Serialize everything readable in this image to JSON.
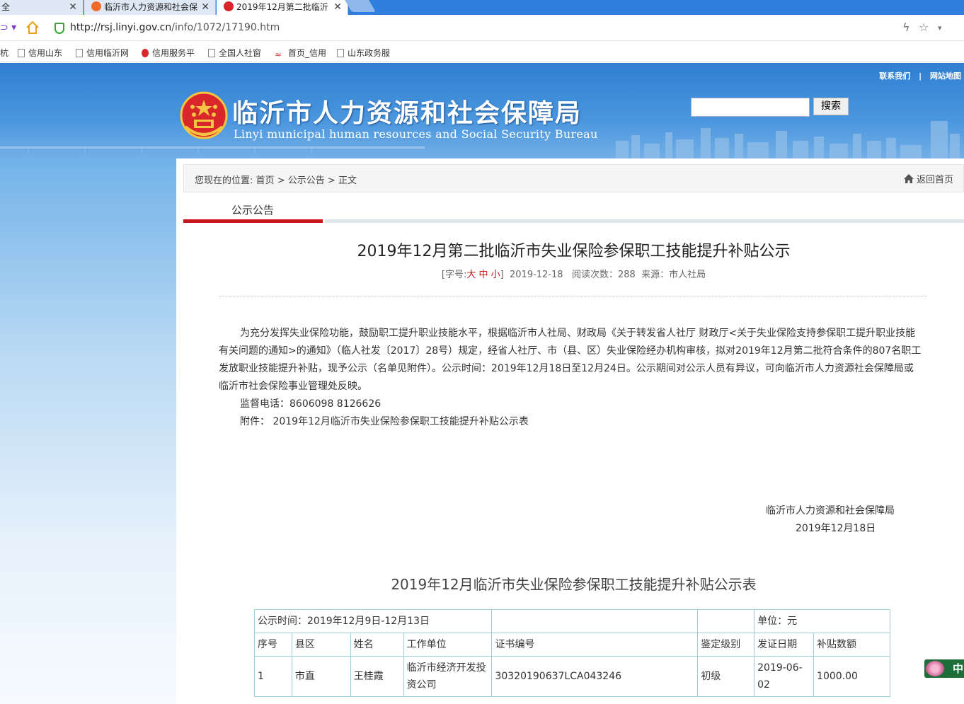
{
  "browser": {
    "tabs": [
      {
        "label": "全",
        "active": false
      },
      {
        "label": "临沂市人力资源和社会保",
        "active": false
      },
      {
        "label": "2019年12月第二批临沂",
        "active": true
      }
    ],
    "url_host": "http://rsj.linyi.gov.cn",
    "url_path": "/info/1072/17190.htm",
    "bookmarks": [
      "杭",
      "信用山东",
      "信用临沂网",
      "信用服务平",
      "全国人社窗",
      "首页_信用",
      "山东政务服"
    ]
  },
  "header": {
    "top_links": [
      "联系我们",
      "|",
      "网站地图"
    ],
    "site_title": "临沂市人力资源和社会保障局",
    "site_subtitle": "Linyi municipal human resources and Social Security Bureau",
    "search_button": "搜索",
    "search_value": ""
  },
  "breadcrumb": {
    "prefix": "您现在的位置:",
    "items": [
      "首页",
      ">",
      "公示公告",
      ">",
      "正文"
    ],
    "home_link": "返回首页"
  },
  "section_tab": "公示公告",
  "article": {
    "title": "2019年12月第二批临沂市失业保险参保职工技能提升补贴公示",
    "meta_prefix": "[字号:",
    "font_sizes": [
      "大",
      "中",
      "小"
    ],
    "meta_suffix": "]",
    "date": "2019-12-18",
    "views_label": "阅读次数：",
    "views": "288",
    "source_label": "来源：",
    "source": "市人社局",
    "paragraph": "为充分发挥失业保险功能，鼓励职工提升职业技能水平，根据临沂市人社局、财政局《关于转发省人社厅 财政厅<关于失业保险支持参保职工提升职业技能有关问题的通知>的通知》（临人社发〔2017〕28号）规定，经省人社厅、市（县、区）失业保险经办机构审核，拟对2019年12月第二批符合条件的807名职工发放职业技能提升补贴，现予公示（名单见附件）。公示时间：2019年12月18日至12月24日。公示期间对公示人员有异议，可向临沂市人力资源社会保障局或临沂市社会保险事业管理处反映。",
    "phone_line": "监督电话：8606098 8126626",
    "attachment_line": "附件： 2019年12月临沂市失业保险参保职工技能提升补贴公示表",
    "sign_org": "临沂市人力资源和社会保障局",
    "sign_date": "2019年12月18日"
  },
  "table": {
    "title": "2019年12月临沂市失业保险参保职工技能提升补贴公示表",
    "period": "公示时间：2019年12月9日-12月13日",
    "unit": "单位：元",
    "headers": [
      "序号",
      "县区",
      "姓名",
      "工作单位",
      "证书编号",
      "鉴定级别",
      "发证日期",
      "补贴数额"
    ],
    "rows": [
      [
        "1",
        "市直",
        "王桂霞",
        "临沂市经济开发投资公司",
        "30320190637LCA043246",
        "初级",
        "2019-06-02",
        "1000.00"
      ]
    ]
  },
  "float_widget": "中"
}
